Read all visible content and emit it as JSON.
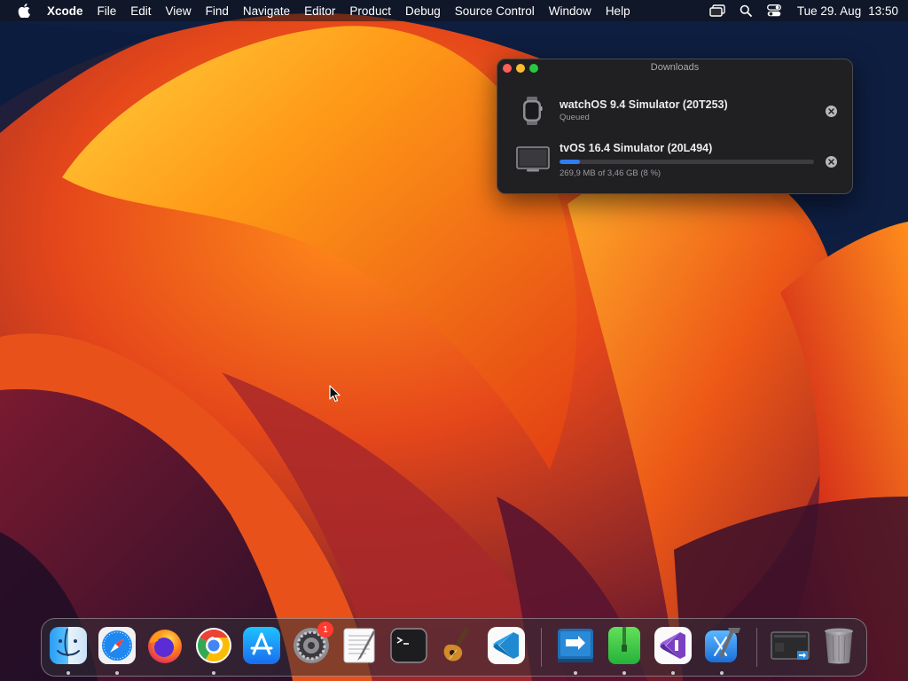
{
  "menubar": {
    "app_name": "Xcode",
    "menus": [
      "File",
      "Edit",
      "View",
      "Find",
      "Navigate",
      "Editor",
      "Product",
      "Debug",
      "Source Control",
      "Window",
      "Help"
    ],
    "clock_date": "Tue 29. Aug",
    "clock_time": "13:50"
  },
  "downloads_window": {
    "title": "Downloads",
    "items": [
      {
        "name": "watchOS 9.4 Simulator (20T253)",
        "status": "Queued",
        "icon": "apple-watch-icon"
      },
      {
        "name": "tvOS 16.4 Simulator (20L494)",
        "status": "269,9 MB of 3,46 GB (8 %)",
        "progress_percent": 8,
        "icon": "apple-tv-icon"
      }
    ]
  },
  "dock": {
    "apps": [
      {
        "name": "Finder",
        "icon": "finder-icon",
        "running": true
      },
      {
        "name": "Safari",
        "icon": "safari-icon",
        "running": true
      },
      {
        "name": "Firefox",
        "icon": "firefox-icon",
        "running": false
      },
      {
        "name": "Google Chrome",
        "icon": "chrome-icon",
        "running": true
      },
      {
        "name": "App Store",
        "icon": "app-store-icon",
        "running": false
      },
      {
        "name": "System Settings",
        "icon": "system-settings-icon",
        "running": false,
        "badge": "1"
      },
      {
        "name": "TextEdit",
        "icon": "textedit-icon",
        "running": false
      },
      {
        "name": "Terminal",
        "icon": "terminal-icon",
        "running": false
      },
      {
        "name": "GarageBand",
        "icon": "garageband-icon",
        "running": false
      },
      {
        "name": "Visual Studio Code",
        "icon": "vscode-icon",
        "running": false
      },
      {
        "name": "Migration Assistant",
        "icon": "migration-assistant-icon",
        "running": true
      },
      {
        "name": "Archive Utility",
        "icon": "archive-utility-icon",
        "running": true
      },
      {
        "name": "Visual Studio",
        "icon": "visual-studio-icon",
        "running": true
      },
      {
        "name": "Xcode",
        "icon": "xcode-icon",
        "running": true
      },
      {
        "name": "Screenshot",
        "icon": "screenshot-icon",
        "running": false
      },
      {
        "name": "Trash",
        "icon": "trash-icon",
        "running": false
      }
    ]
  },
  "colors": {
    "menubar_bg": "#121216",
    "window_bg": "#202022",
    "progress_fill": "#2f7cf6",
    "traffic_close": "#ff5f57",
    "traffic_min": "#febc2e",
    "traffic_max": "#28c840",
    "badge": "#ff3b30"
  }
}
